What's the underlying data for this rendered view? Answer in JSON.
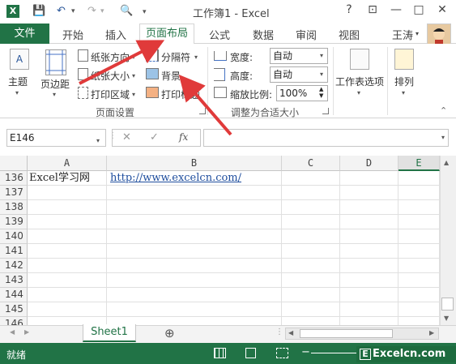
{
  "window": {
    "title": "工作簿1 - Excel",
    "controls": [
      "?",
      "⊡",
      "—",
      "□",
      "✕"
    ]
  },
  "tabs": {
    "file": "文件",
    "items": [
      "开始",
      "插入",
      "页面布局",
      "公式",
      "数据",
      "审阅",
      "视图"
    ],
    "active": "页面布局",
    "user": "王涛"
  },
  "ribbon": {
    "theme": "主题",
    "margins": "页边距",
    "orientation": "纸张方向",
    "size": "纸张大小",
    "print_area": "打印区域",
    "breaks": "分隔符",
    "background": "背景",
    "print_titles": "打印标题",
    "group_page_setup": "页面设置",
    "width_label": "宽度:",
    "width_value": "自动",
    "height_label": "高度:",
    "height_value": "自动",
    "scale_label": "缩放比例:",
    "scale_value": "100%",
    "group_scale": "调整为合适大小",
    "sheet_options": "工作表选项",
    "arrange": "排列"
  },
  "formula_bar": {
    "name_box": "E146",
    "fx": "fx",
    "cancel": "✕",
    "enter": "✓",
    "formula": ""
  },
  "grid": {
    "columns": [
      "A",
      "B",
      "C",
      "D",
      "E"
    ],
    "rows": [
      "136",
      "137",
      "138",
      "139",
      "140",
      "141",
      "142",
      "143",
      "144",
      "145",
      "146"
    ],
    "a136": "Excel学习网",
    "b136": "http://www.excelcn.com/"
  },
  "sheets": {
    "items": [
      "Sheet1"
    ],
    "add": "⊕"
  },
  "status": {
    "ready": "就绪",
    "watermark": "Excelcn.com"
  },
  "colors": {
    "accent": "#217346",
    "arrow": "#e03a3a"
  }
}
